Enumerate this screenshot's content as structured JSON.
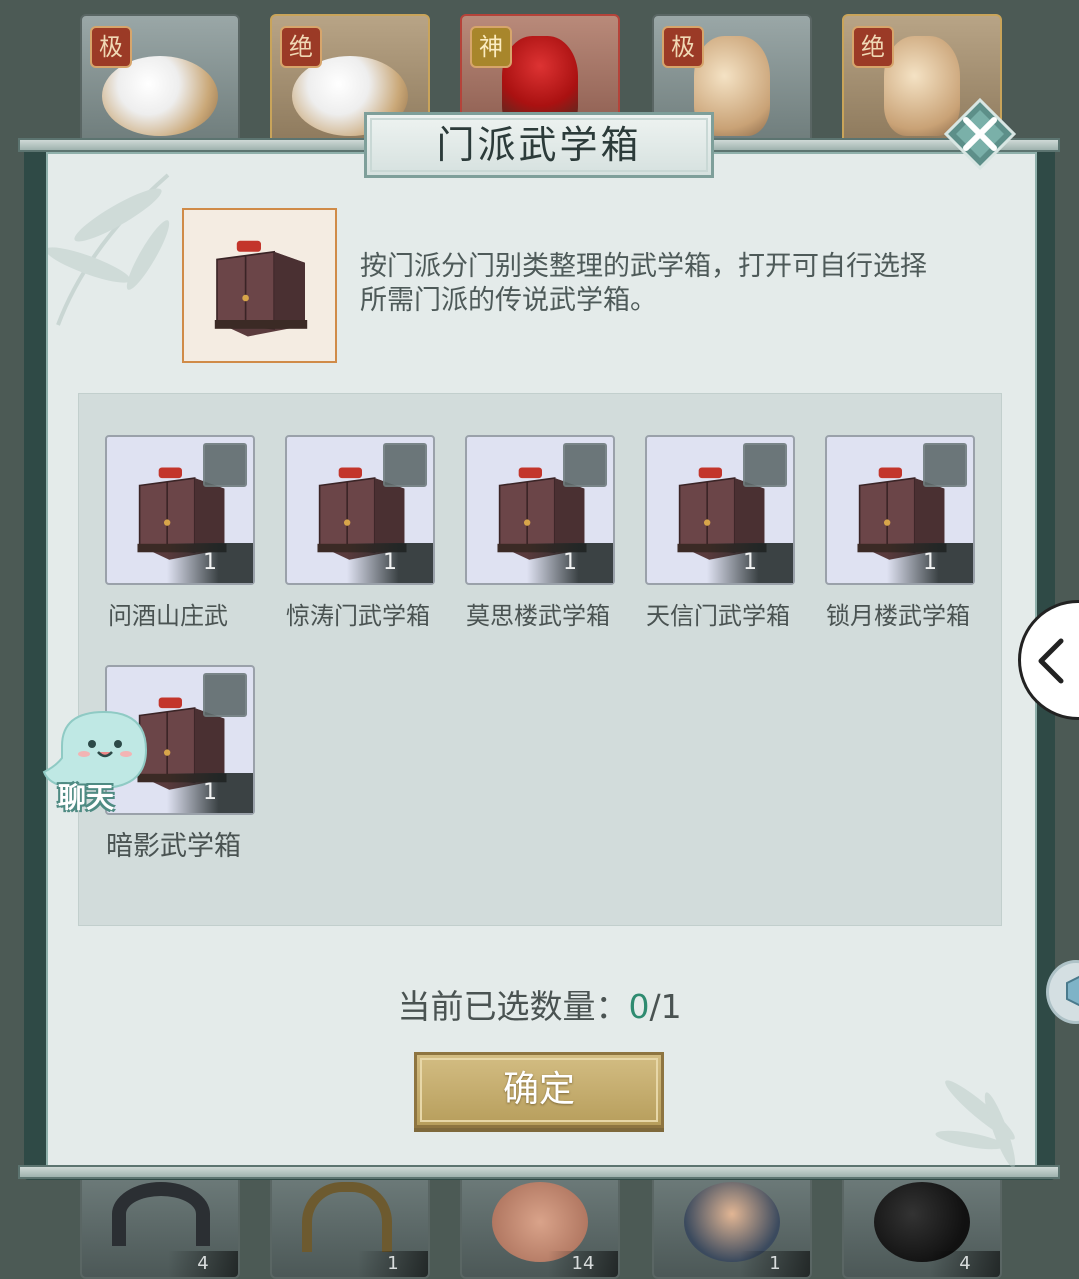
{
  "dialog": {
    "title": "门派武学箱",
    "description": "按门派分门别类整理的武学箱，打开可自行选择所需门派的传说武学箱。"
  },
  "items": [
    {
      "label": "问酒山庄武",
      "count": "1"
    },
    {
      "label": "惊涛门武学箱",
      "count": "1"
    },
    {
      "label": "莫思楼武学箱",
      "count": "1"
    },
    {
      "label": "天信门武学箱",
      "count": "1"
    },
    {
      "label": "锁月楼武学箱",
      "count": "1"
    },
    {
      "label": "暗影武学箱",
      "count": "1"
    }
  ],
  "selection": {
    "prefix": "当前已选数量：",
    "selected": "0",
    "separator": "/",
    "max": "1"
  },
  "confirm_label": "确定",
  "chat": {
    "label": "聊天"
  },
  "background": {
    "top_grades": [
      "极",
      "绝",
      "神",
      "极",
      "绝"
    ],
    "bottom_counts": [
      "4",
      "1",
      "14",
      "1",
      "4"
    ]
  }
}
